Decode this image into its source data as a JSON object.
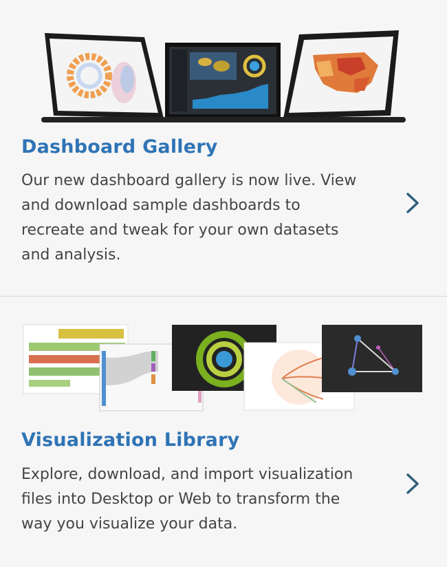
{
  "cards": [
    {
      "title": "Dashboard Gallery",
      "description_lines": [
        "Our new dashboard gallery is now live. View",
        "and download sample dashboards to",
        "recreate and tweak for your own datasets",
        "and analysis."
      ],
      "illustration": "three-dashboard-laptops",
      "chevron_icon": "chevron-right-icon"
    },
    {
      "title": "Visualization Library",
      "description_lines": [
        "Explore, download, and import visualization",
        "files into Desktop or Web to transform the",
        "way you visualize your data."
      ],
      "illustration": "visualization-thumbnails",
      "chevron_icon": "chevron-right-icon"
    }
  ],
  "colors": {
    "title": "#2f74b5",
    "body_text": "#444444",
    "background": "#f6f6f6",
    "chevron": "#2f5f7a"
  }
}
